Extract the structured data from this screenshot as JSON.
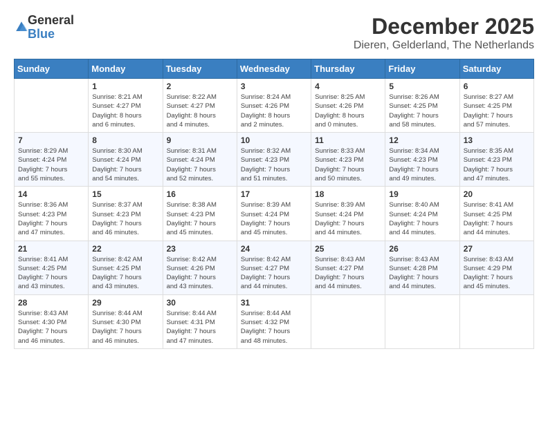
{
  "logo": {
    "general": "General",
    "blue": "Blue"
  },
  "title": "December 2025",
  "location": "Dieren, Gelderland, The Netherlands",
  "weekdays": [
    "Sunday",
    "Monday",
    "Tuesday",
    "Wednesday",
    "Thursday",
    "Friday",
    "Saturday"
  ],
  "weeks": [
    [
      {
        "day": "",
        "info": ""
      },
      {
        "day": "1",
        "info": "Sunrise: 8:21 AM\nSunset: 4:27 PM\nDaylight: 8 hours\nand 6 minutes."
      },
      {
        "day": "2",
        "info": "Sunrise: 8:22 AM\nSunset: 4:27 PM\nDaylight: 8 hours\nand 4 minutes."
      },
      {
        "day": "3",
        "info": "Sunrise: 8:24 AM\nSunset: 4:26 PM\nDaylight: 8 hours\nand 2 minutes."
      },
      {
        "day": "4",
        "info": "Sunrise: 8:25 AM\nSunset: 4:26 PM\nDaylight: 8 hours\nand 0 minutes."
      },
      {
        "day": "5",
        "info": "Sunrise: 8:26 AM\nSunset: 4:25 PM\nDaylight: 7 hours\nand 58 minutes."
      },
      {
        "day": "6",
        "info": "Sunrise: 8:27 AM\nSunset: 4:25 PM\nDaylight: 7 hours\nand 57 minutes."
      }
    ],
    [
      {
        "day": "7",
        "info": "Sunrise: 8:29 AM\nSunset: 4:24 PM\nDaylight: 7 hours\nand 55 minutes."
      },
      {
        "day": "8",
        "info": "Sunrise: 8:30 AM\nSunset: 4:24 PM\nDaylight: 7 hours\nand 54 minutes."
      },
      {
        "day": "9",
        "info": "Sunrise: 8:31 AM\nSunset: 4:24 PM\nDaylight: 7 hours\nand 52 minutes."
      },
      {
        "day": "10",
        "info": "Sunrise: 8:32 AM\nSunset: 4:23 PM\nDaylight: 7 hours\nand 51 minutes."
      },
      {
        "day": "11",
        "info": "Sunrise: 8:33 AM\nSunset: 4:23 PM\nDaylight: 7 hours\nand 50 minutes."
      },
      {
        "day": "12",
        "info": "Sunrise: 8:34 AM\nSunset: 4:23 PM\nDaylight: 7 hours\nand 49 minutes."
      },
      {
        "day": "13",
        "info": "Sunrise: 8:35 AM\nSunset: 4:23 PM\nDaylight: 7 hours\nand 47 minutes."
      }
    ],
    [
      {
        "day": "14",
        "info": "Sunrise: 8:36 AM\nSunset: 4:23 PM\nDaylight: 7 hours\nand 47 minutes."
      },
      {
        "day": "15",
        "info": "Sunrise: 8:37 AM\nSunset: 4:23 PM\nDaylight: 7 hours\nand 46 minutes."
      },
      {
        "day": "16",
        "info": "Sunrise: 8:38 AM\nSunset: 4:23 PM\nDaylight: 7 hours\nand 45 minutes."
      },
      {
        "day": "17",
        "info": "Sunrise: 8:39 AM\nSunset: 4:24 PM\nDaylight: 7 hours\nand 45 minutes."
      },
      {
        "day": "18",
        "info": "Sunrise: 8:39 AM\nSunset: 4:24 PM\nDaylight: 7 hours\nand 44 minutes."
      },
      {
        "day": "19",
        "info": "Sunrise: 8:40 AM\nSunset: 4:24 PM\nDaylight: 7 hours\nand 44 minutes."
      },
      {
        "day": "20",
        "info": "Sunrise: 8:41 AM\nSunset: 4:25 PM\nDaylight: 7 hours\nand 44 minutes."
      }
    ],
    [
      {
        "day": "21",
        "info": "Sunrise: 8:41 AM\nSunset: 4:25 PM\nDaylight: 7 hours\nand 43 minutes."
      },
      {
        "day": "22",
        "info": "Sunrise: 8:42 AM\nSunset: 4:25 PM\nDaylight: 7 hours\nand 43 minutes."
      },
      {
        "day": "23",
        "info": "Sunrise: 8:42 AM\nSunset: 4:26 PM\nDaylight: 7 hours\nand 43 minutes."
      },
      {
        "day": "24",
        "info": "Sunrise: 8:42 AM\nSunset: 4:27 PM\nDaylight: 7 hours\nand 44 minutes."
      },
      {
        "day": "25",
        "info": "Sunrise: 8:43 AM\nSunset: 4:27 PM\nDaylight: 7 hours\nand 44 minutes."
      },
      {
        "day": "26",
        "info": "Sunrise: 8:43 AM\nSunset: 4:28 PM\nDaylight: 7 hours\nand 44 minutes."
      },
      {
        "day": "27",
        "info": "Sunrise: 8:43 AM\nSunset: 4:29 PM\nDaylight: 7 hours\nand 45 minutes."
      }
    ],
    [
      {
        "day": "28",
        "info": "Sunrise: 8:43 AM\nSunset: 4:30 PM\nDaylight: 7 hours\nand 46 minutes."
      },
      {
        "day": "29",
        "info": "Sunrise: 8:44 AM\nSunset: 4:30 PM\nDaylight: 7 hours\nand 46 minutes."
      },
      {
        "day": "30",
        "info": "Sunrise: 8:44 AM\nSunset: 4:31 PM\nDaylight: 7 hours\nand 47 minutes."
      },
      {
        "day": "31",
        "info": "Sunrise: 8:44 AM\nSunset: 4:32 PM\nDaylight: 7 hours\nand 48 minutes."
      },
      {
        "day": "",
        "info": ""
      },
      {
        "day": "",
        "info": ""
      },
      {
        "day": "",
        "info": ""
      }
    ]
  ]
}
